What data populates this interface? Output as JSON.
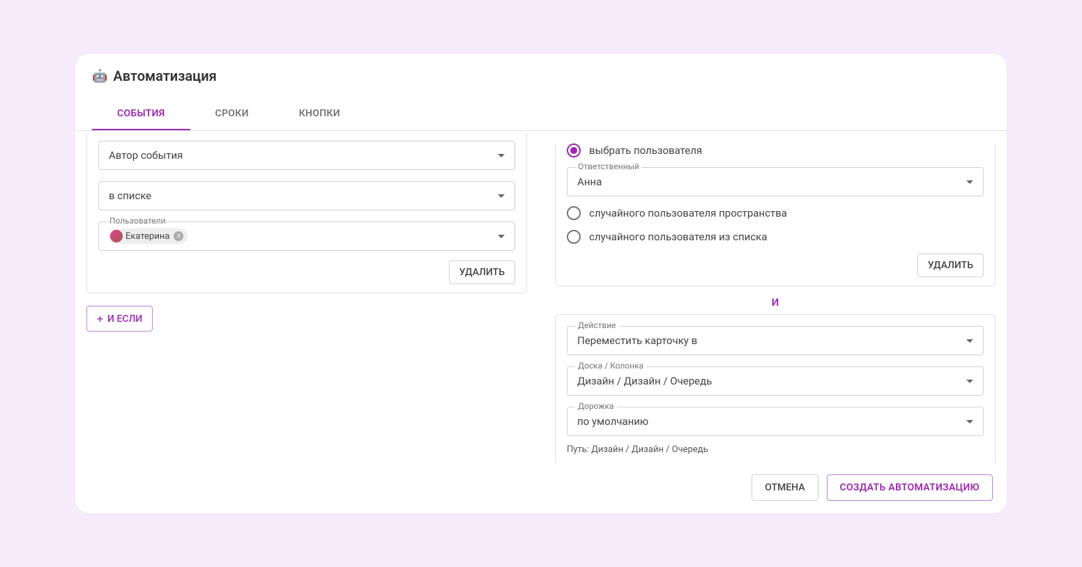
{
  "title": "Автоматизация",
  "title_icon": "🤖",
  "tabs": {
    "events": "СОБЫТИЯ",
    "deadlines": "СРОКИ",
    "buttons": "КНОПКИ"
  },
  "left": {
    "event_author_label": "Автор события",
    "in_list_label": "в списке",
    "users_field_label": "Пользователи",
    "user_chip_name": "Екатерина",
    "delete_label": "УДАЛИТЬ",
    "and_if_label": "И ЕСЛИ"
  },
  "right": {
    "radio_choose_user": "выбрать пользователя",
    "responsible_label": "Ответственный",
    "responsible_value": "Анна",
    "radio_random_space": "случайного пользователя пространства",
    "radio_random_list": "случайного пользователя из списка",
    "delete_label": "УДАЛИТЬ",
    "separator_and": "И",
    "action_label": "Действие",
    "action_value": "Переместить карточку в",
    "board_col_label": "Доска / Колонка",
    "board_col_value": "Дизайн / Дизайн / Очередь",
    "lane_label": "Дорожка",
    "lane_value": "по умолчанию",
    "path_label": "Путь: Дизайн / Дизайн / Очередь"
  },
  "footer": {
    "cancel": "ОТМЕНА",
    "create": "СОЗДАТЬ АВТОМАТИЗАЦИЮ"
  }
}
